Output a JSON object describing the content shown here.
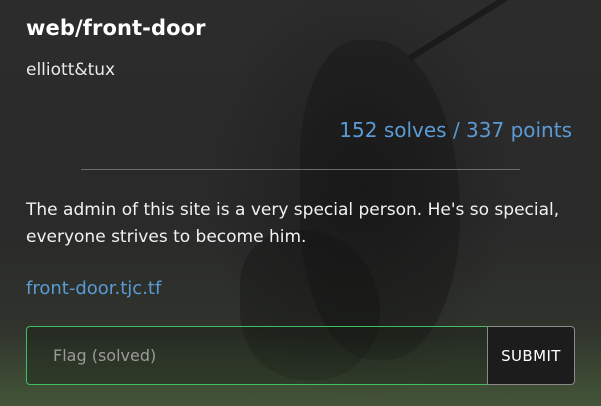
{
  "challenge": {
    "title": "web/front-door",
    "author": "elliott&tux",
    "stats": "152 solves / 337 points",
    "description": "The admin of this site is a very special person. He's so special, everyone strives to become him.",
    "link_text": "front-door.tjc.tf"
  },
  "flag_form": {
    "placeholder": "Flag (solved)",
    "value": "",
    "submit_label": "SUBMIT"
  },
  "colors": {
    "accent": "#5b9bd5",
    "input_border_solved": "#3fbf5f",
    "background": "#2b2b2b"
  }
}
